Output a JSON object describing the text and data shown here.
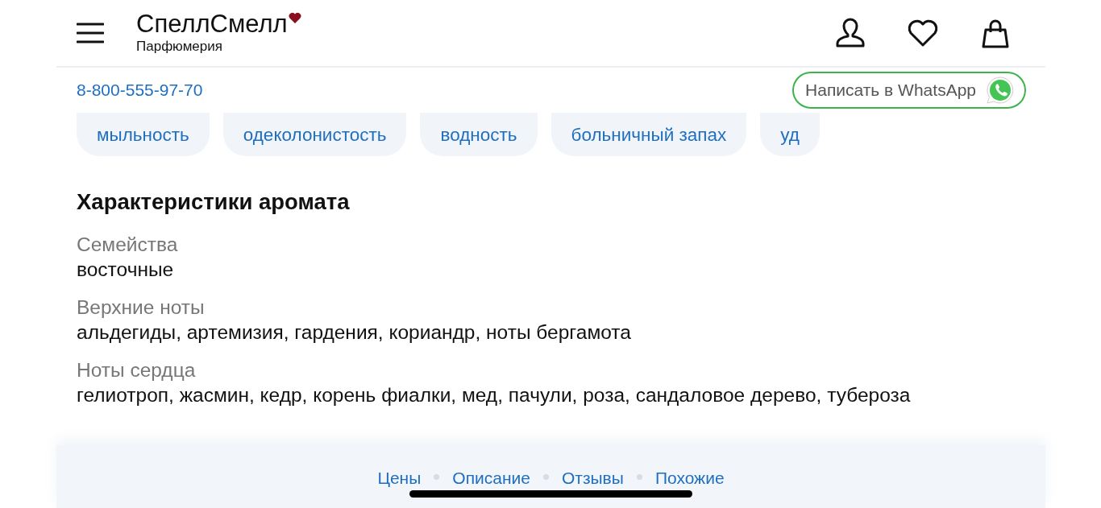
{
  "header": {
    "logo": "СпеллСмелл",
    "subtitle": "Парфюмерия"
  },
  "contact": {
    "phone": "8-800-555-97-70",
    "whatsapp_button": "Написать в WhatsApp"
  },
  "tags": [
    "мыльность",
    "одеколонистость",
    "водность",
    "больничный запах",
    "уд"
  ],
  "section": {
    "title": "Характеристики аромата",
    "fields": [
      {
        "label": "Семейства",
        "value": "восточные"
      },
      {
        "label": "Верхние ноты",
        "value": "альдегиды, артемизия, гардения, кориандр, ноты бергамота"
      },
      {
        "label": "Ноты сердца",
        "value": "гелиотроп, жасмин, кедр, корень фиалки, мед, пачули, роза, сандаловое дерево, тубероза"
      }
    ]
  },
  "bottom_nav": [
    "Цены",
    "Описание",
    "Отзывы",
    "Похожие"
  ]
}
